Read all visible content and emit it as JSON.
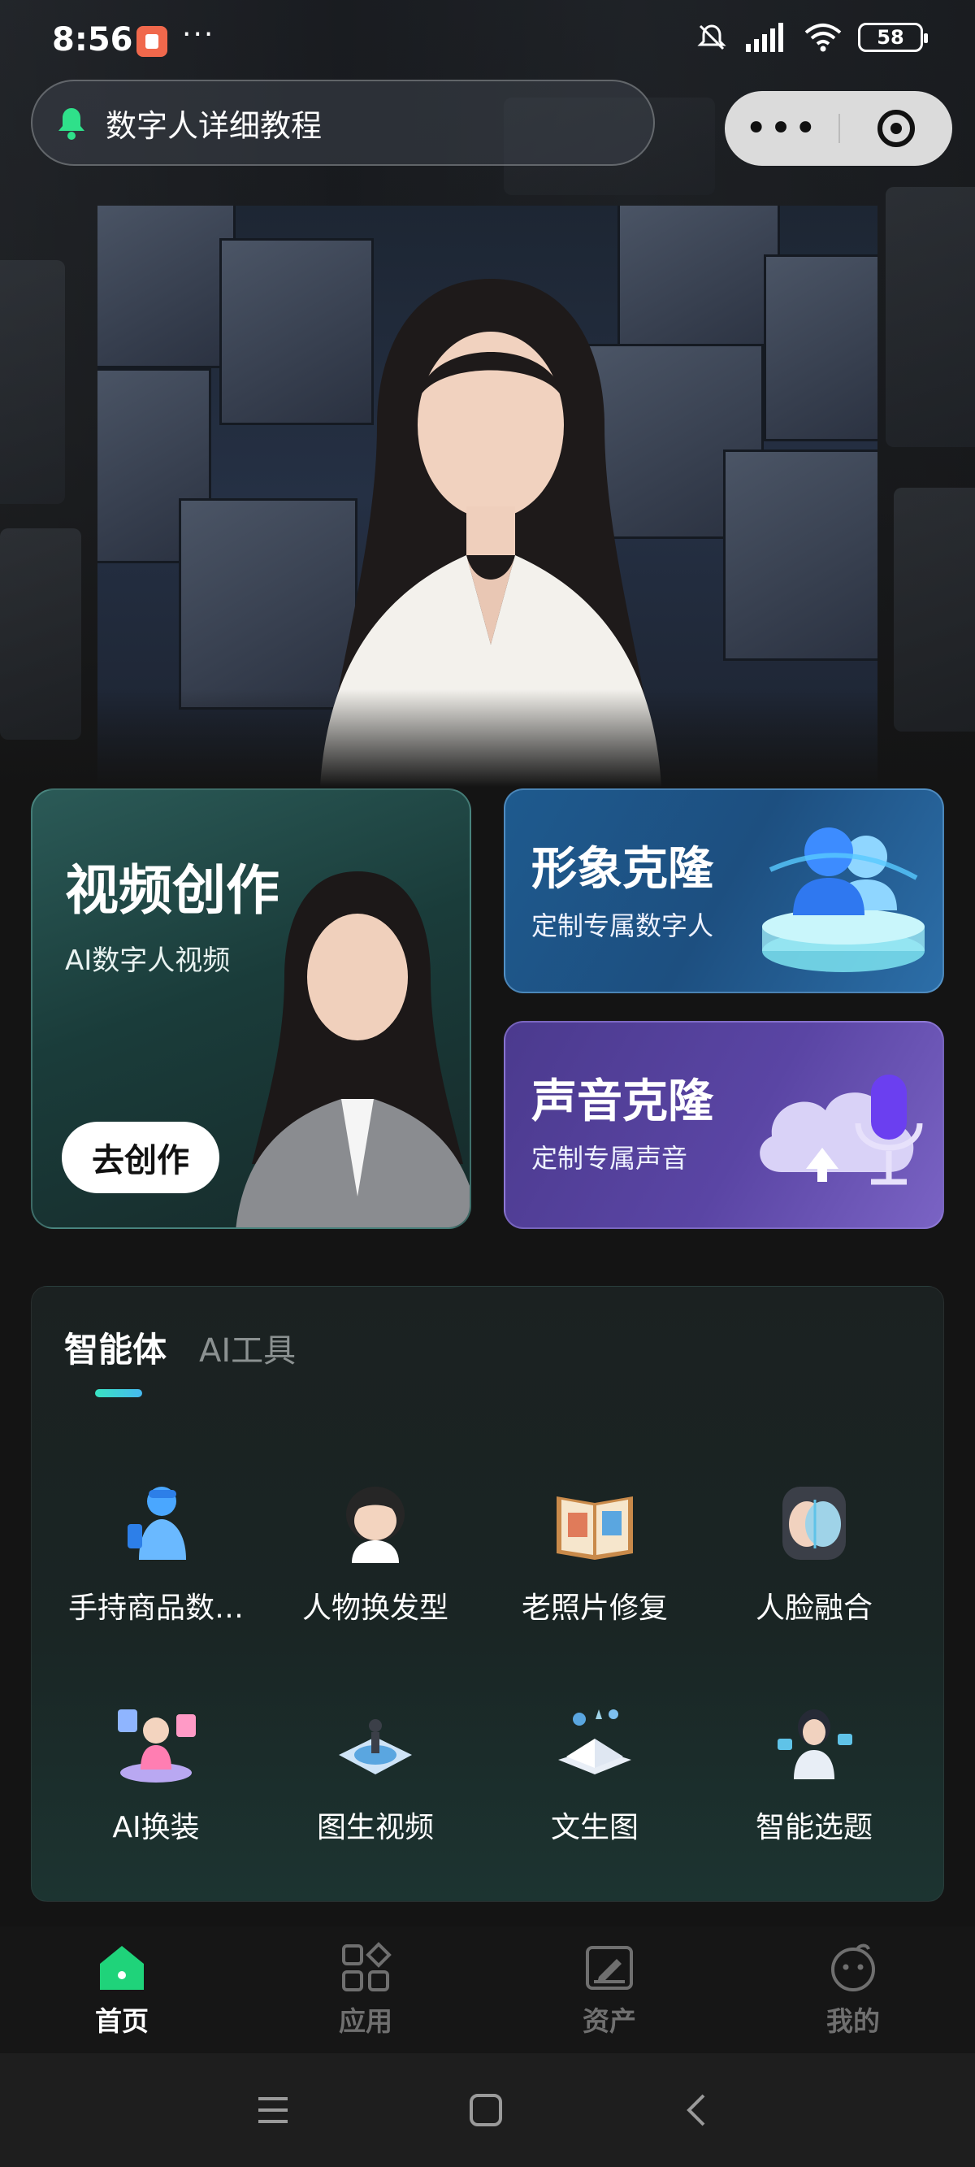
{
  "status_bar": {
    "time": "8:56",
    "more": "···",
    "battery": "58"
  },
  "top_bar": {
    "title": "数字人详细教程",
    "capsule_more": "•••"
  },
  "cards": {
    "video": {
      "title": "视频创作",
      "subtitle": "AI数字人视频",
      "cta": "去创作"
    },
    "image_clone": {
      "title": "形象克隆",
      "subtitle": "定制专属数字人"
    },
    "voice_clone": {
      "title": "声音克隆",
      "subtitle": "定制专属声音"
    }
  },
  "tools_panel": {
    "tabs": [
      {
        "label": "智能体",
        "active": true
      },
      {
        "label": "AI工具",
        "active": false
      }
    ],
    "items": [
      {
        "label": "手持商品数…",
        "icon": "product-avatar-icon"
      },
      {
        "label": "人物换发型",
        "icon": "hairstyle-icon"
      },
      {
        "label": "老照片修复",
        "icon": "photo-album-icon"
      },
      {
        "label": "人脸融合",
        "icon": "face-fusion-icon"
      },
      {
        "label": "AI换装",
        "icon": "outfit-change-icon"
      },
      {
        "label": "图生视频",
        "icon": "image-to-video-icon"
      },
      {
        "label": "文生图",
        "icon": "text-to-image-icon"
      },
      {
        "label": "智能选题",
        "icon": "smart-topic-icon"
      }
    ]
  },
  "bottom_nav": [
    {
      "label": "首页",
      "icon": "home-icon",
      "active": true
    },
    {
      "label": "应用",
      "icon": "apps-icon",
      "active": false
    },
    {
      "label": "资产",
      "icon": "assets-icon",
      "active": false
    },
    {
      "label": "我的",
      "icon": "profile-icon",
      "active": false
    }
  ],
  "colors": {
    "accent": "#1fd37a",
    "background": "#141414",
    "tab_indicator": "#39e3c2"
  }
}
